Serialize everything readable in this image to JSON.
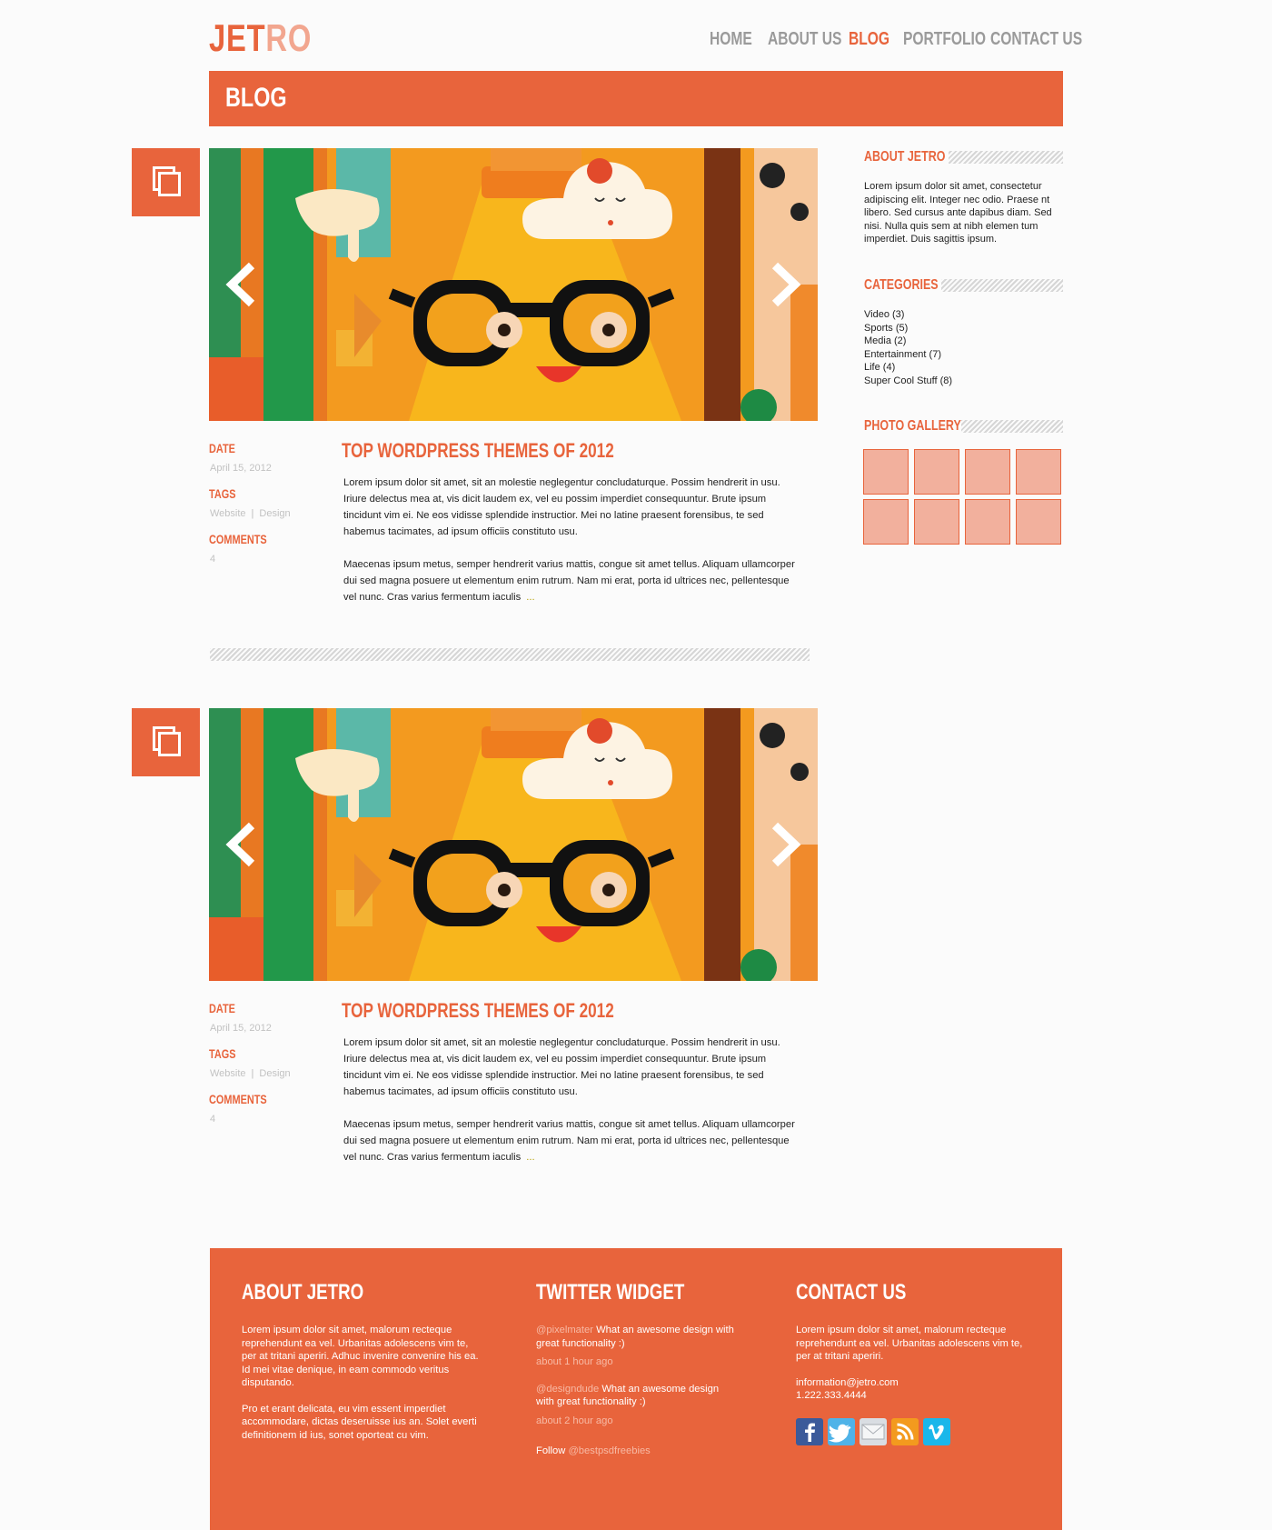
{
  "header": {
    "logo_part1": "JET",
    "logo_part2": "RO",
    "nav": [
      "HOME",
      "ABOUT US",
      "BLOG",
      "PORTFOLIO",
      "CONTACT US"
    ],
    "active_nav": "BLOG"
  },
  "page_title": "BLOG",
  "posts": [
    {
      "date_label": "DATE",
      "date": "April 15, 2012",
      "tags_label": "TAGS",
      "tags": [
        "Website",
        "Design"
      ],
      "comments_label": "COMMENTS",
      "comments": "4",
      "title": "TOP WORDPRESS THEMES OF 2012",
      "para1": "Lorem ipsum dolor sit amet, sit an molestie neglegentur concludaturque. Possim hendrerit in usu. Iriure delectus mea at, vis dicit laudem ex, vel eu possim imperdiet consequuntur. Brute ipsum tincidunt vim ei. Ne eos vidisse splendide instructior. Mei no latine praesent forensibus, te sed habemus tacimates, ad ipsum officiis constituto usu.",
      "para2": "Maecenas ipsum metus, semper hendrerit varius mattis, congue sit amet tellus. Aliquam ullamcorper dui sed magna posuere ut elementum enim rutrum. Nam mi erat, porta id ultrices nec, pellentesque vel nunc. Cras varius fermentum iaculis",
      "more": "..."
    },
    {
      "date_label": "DATE",
      "date": "April 15, 2012",
      "tags_label": "TAGS",
      "tags": [
        "Website",
        "Design"
      ],
      "comments_label": "COMMENTS",
      "comments": "4",
      "title": "TOP WORDPRESS THEMES OF 2012",
      "para1": "Lorem ipsum dolor sit amet, sit an molestie neglegentur concludaturque. Possim hendrerit in usu. Iriure delectus mea at, vis dicit laudem ex, vel eu possim imperdiet consequuntur. Brute ipsum tincidunt vim ei. Ne eos vidisse splendide instructior. Mei no latine praesent forensibus, te sed habemus tacimates, ad ipsum officiis constituto usu.",
      "para2": "Maecenas ipsum metus, semper hendrerit varius mattis, congue sit amet tellus. Aliquam ullamcorper dui sed magna posuere ut elementum enim rutrum. Nam mi erat, porta id ultrices nec, pellentesque vel nunc. Cras varius fermentum iaculis",
      "more": "..."
    }
  ],
  "sidebar": {
    "about_title": "ABOUT JETRO",
    "about_text": "Lorem ipsum dolor sit amet, consectetur adipiscing elit. Integer nec odio. Praese nt libero. Sed cursus ante dapibus diam. Sed nisi. Nulla quis sem at nibh elemen tum imperdiet. Duis sagittis ipsum.",
    "categories_title": "CATEGORIES",
    "categories": [
      "Video (3)",
      "Sports (5)",
      "Media (2)",
      "Entertainment (7)",
      "Life (4)",
      "Super Cool Stuff (8)"
    ],
    "gallery_title": "PHOTO GALLERY"
  },
  "footer": {
    "about_title": "ABOUT JETRO",
    "about_p1": "Lorem ipsum dolor sit amet, malorum recteque reprehendunt ea vel. Urbanitas adolescens vim te, per at tritani aperiri. Adhuc invenire convenire his ea. Id mei vitae denique, in eam commodo veritus disputando.",
    "about_p2": "Pro et erant delicata, eu vim essent imperdiet accommodare, dictas deseruisse ius an. Solet everti definitionem id ius, sonet oporteat cu vim.",
    "twitter_title": "TWITTER WIDGET",
    "tweets": [
      {
        "handle": "@pixelmater",
        "text": "What an awesome design with great functionality :)",
        "time": "about 1 hour ago"
      },
      {
        "handle": "@designdude",
        "text": "What an awesome design with great functionality :)",
        "time": "about 2 hour ago"
      }
    ],
    "follow_label": "Follow",
    "follow_handle": "@bestpsdfreebies",
    "contact_title": "CONTACT US",
    "contact_text": "Lorem ipsum dolor sit amet, malorum recteque reprehendunt ea vel. Urbanitas adolescens vim te, per at tritani aperiri.",
    "email": "information@jetro.com",
    "phone": "1.222.333.4444",
    "social_icons": [
      "facebook-icon",
      "twitter-icon",
      "mail-icon",
      "rss-icon",
      "vimeo-icon"
    ]
  },
  "colors": {
    "accent": "#e8643c",
    "accent_light": "#f2b09d"
  }
}
